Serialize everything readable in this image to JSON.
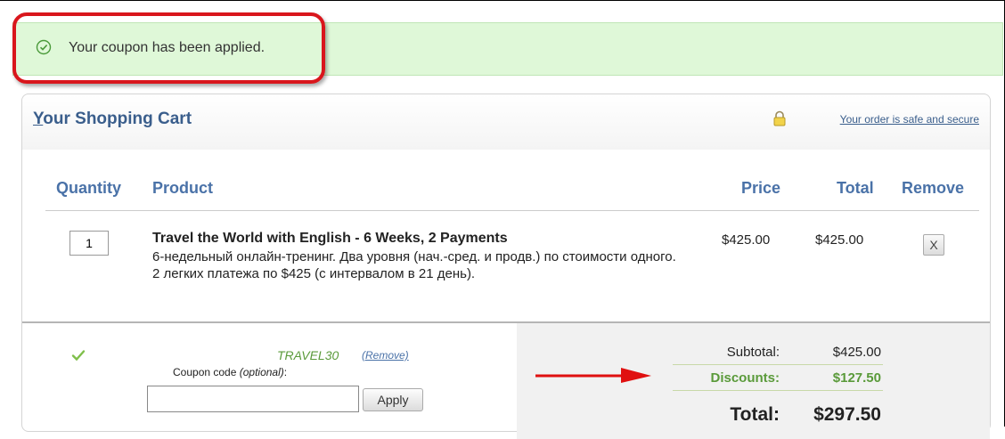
{
  "notice": {
    "message": "Your coupon has been applied.",
    "icon": "check-circle-icon"
  },
  "cart": {
    "title_first": "Y",
    "title_rest": "our Shopping Cart",
    "secure_link": "Your order is safe and secure",
    "columns": {
      "quantity": "Quantity",
      "product": "Product",
      "price": "Price",
      "total": "Total",
      "remove": "Remove"
    },
    "items": [
      {
        "quantity": "1",
        "name": "Travel the World with English - 6 Weeks, 2 Payments",
        "description": "6-недельный онлайн-тренинг. Два уровня (нач.-сред. и продв.) по стоимости одного. 2 легких платежа по $425 (с интервалом в 21 день).",
        "price": "$425.00",
        "total": "$425.00",
        "remove_label": "X"
      }
    ]
  },
  "coupon": {
    "code": "TRAVEL30",
    "remove_label": "(Remove)",
    "label": "Coupon code",
    "label_optional": "(optional)",
    "label_colon": ":",
    "input_value": "",
    "apply_label": "Apply"
  },
  "summary": {
    "subtotal_label": "Subtotal:",
    "subtotal_value": "$425.00",
    "discounts_label": "Discounts:",
    "discounts_value": "$127.50",
    "total_label": "Total:",
    "total_value": "$297.50"
  },
  "colors": {
    "accent": "#4a72a8",
    "success": "#5a9a3a",
    "notice_bg": "#dff8d8",
    "highlight": "#d9161c"
  }
}
